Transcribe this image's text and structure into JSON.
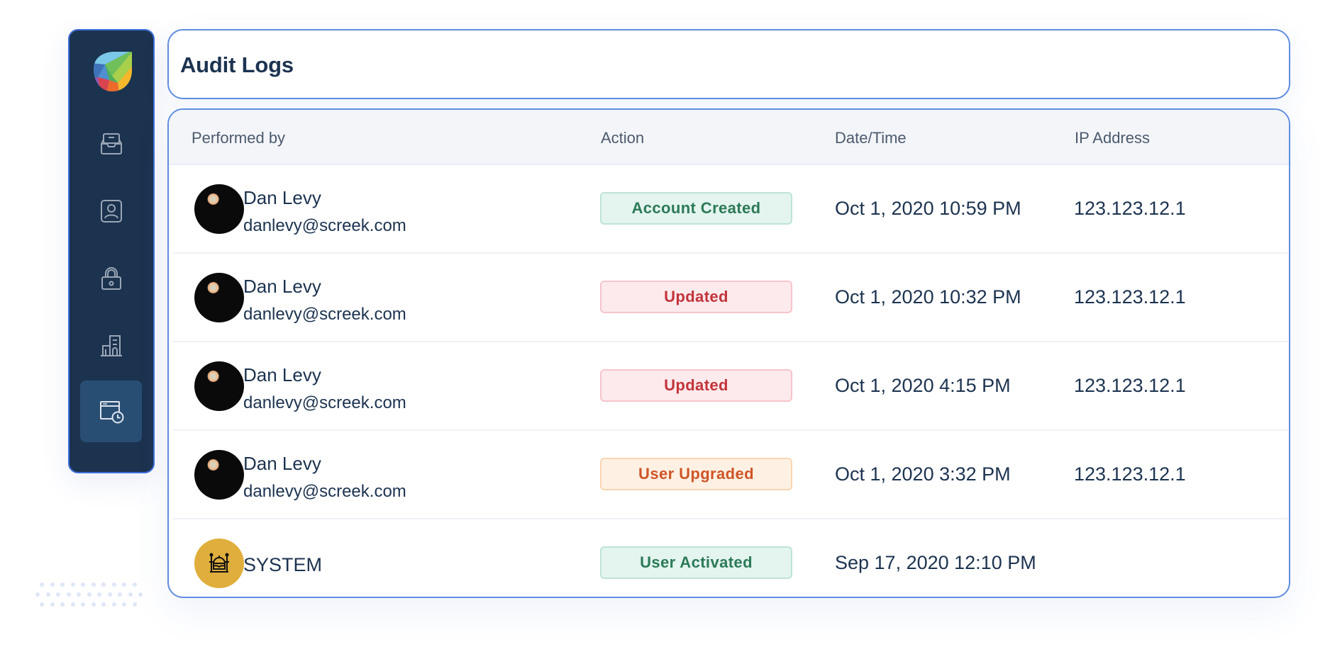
{
  "page": {
    "title": "Audit Logs"
  },
  "sidebar": {
    "logo": "colorful-leaf-logo",
    "items": [
      {
        "name": "inbox",
        "icon": "inbox-tray-icon",
        "active": false
      },
      {
        "name": "users",
        "icon": "user-badge-icon",
        "active": false
      },
      {
        "name": "security",
        "icon": "lock-icon",
        "active": false
      },
      {
        "name": "organization",
        "icon": "building-icon",
        "active": false
      },
      {
        "name": "audit-logs",
        "icon": "window-clock-icon",
        "active": true
      }
    ]
  },
  "table": {
    "columns": [
      "Performed by",
      "Action",
      "Date/Time",
      "IP Address"
    ],
    "rows": [
      {
        "name": "Dan Levy",
        "email": "danlevy@screek.com",
        "avatar": "photo",
        "action": "Account Created",
        "action_color": "green",
        "datetime": "Oct 1, 2020 10:59 PM",
        "ip": "123.123.12.1"
      },
      {
        "name": "Dan Levy",
        "email": "danlevy@screek.com",
        "avatar": "photo",
        "action": "Updated",
        "action_color": "red",
        "datetime": "Oct 1, 2020 10:32 PM",
        "ip": "123.123.12.1"
      },
      {
        "name": "Dan Levy",
        "email": "danlevy@screek.com",
        "avatar": "photo",
        "action": "Updated",
        "action_color": "red",
        "datetime": "Oct 1, 2020 4:15 PM",
        "ip": "123.123.12.1"
      },
      {
        "name": "Dan Levy",
        "email": "danlevy@screek.com",
        "avatar": "photo",
        "action": "User Upgraded",
        "action_color": "orange",
        "datetime": "Oct 1, 2020 3:32 PM",
        "ip": "123.123.12.1"
      },
      {
        "name": "SYSTEM",
        "email": "",
        "avatar": "system-robot-icon",
        "action": "User Activated",
        "action_color": "green",
        "datetime": "Sep 17, 2020 12:10 PM",
        "ip": ""
      }
    ]
  },
  "colors": {
    "sidebar_bg": "#1c334f",
    "sidebar_active": "#294e74",
    "border_accent": "#5f8de0",
    "badge_green": "#2b7a57",
    "badge_red": "#c2343a",
    "badge_orange": "#cf5528",
    "system_avatar": "#e0ae3c"
  }
}
